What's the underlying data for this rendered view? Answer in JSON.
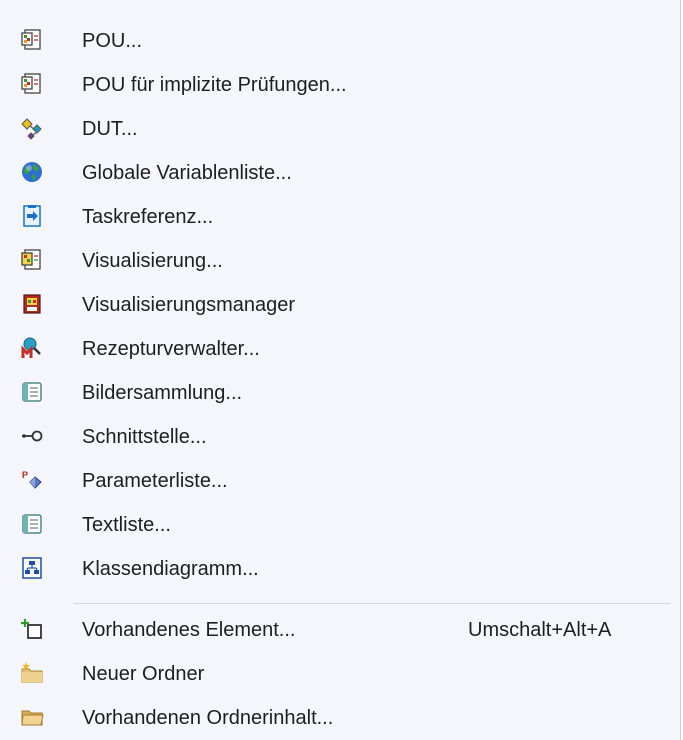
{
  "menu": {
    "items": [
      {
        "label": "POU...",
        "icon": "pou-icon"
      },
      {
        "label": "POU für implizite Prüfungen...",
        "icon": "pou-implicit-checks-icon"
      },
      {
        "label": "DUT...",
        "icon": "dut-icon"
      },
      {
        "label": "Globale Variablenliste...",
        "icon": "globe-icon"
      },
      {
        "label": "Taskreferenz...",
        "icon": "task-reference-icon"
      },
      {
        "label": "Visualisierung...",
        "icon": "visualization-icon"
      },
      {
        "label": "Visualisierungsmanager",
        "icon": "visualization-manager-icon"
      },
      {
        "label": "Rezepturverwalter...",
        "icon": "recipe-manager-icon"
      },
      {
        "label": "Bildersammlung...",
        "icon": "image-pool-icon"
      },
      {
        "label": "Schnittstelle...",
        "icon": "interface-icon"
      },
      {
        "label": "Parameterliste...",
        "icon": "parameter-list-icon"
      },
      {
        "label": "Textliste...",
        "icon": "text-list-icon"
      },
      {
        "label": "Klassendiagramm...",
        "icon": "class-diagram-icon"
      },
      {
        "label": "Vorhandenes Element...",
        "icon": "add-existing-item-icon",
        "shortcut": "Umschalt+Alt+A"
      },
      {
        "label": "Neuer Ordner",
        "icon": "new-folder-icon"
      },
      {
        "label": "Vorhandenen Ordnerinhalt...",
        "icon": "folder-icon"
      }
    ]
  }
}
